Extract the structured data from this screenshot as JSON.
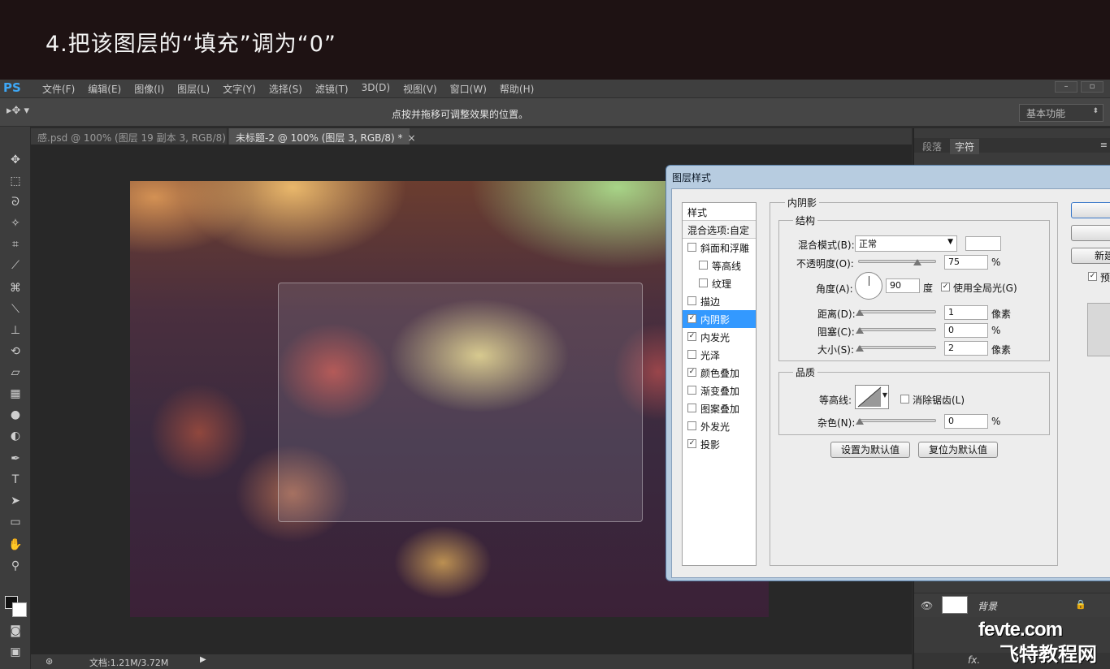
{
  "banner": {
    "text": "4.把该图层的“填充”调为“0”"
  },
  "app": {
    "logo": "PS",
    "menu": [
      "文件(F)",
      "编辑(E)",
      "图像(I)",
      "图层(L)",
      "文字(Y)",
      "选择(S)",
      "滤镜(T)",
      "3D(D)",
      "视图(V)",
      "窗口(W)",
      "帮助(H)"
    ]
  },
  "options_bar": {
    "tool_icon": "move-tool-icon",
    "hint": "点按并拖移可调整效果的位置。",
    "workspace": "基本功能"
  },
  "tabs": [
    {
      "label": "感.psd @ 100% (图层 19 副本 3, RGB/8) *",
      "close": "×"
    },
    {
      "label": "未标题-2 @ 100% (图层 3, RGB/8) *",
      "close": "×"
    }
  ],
  "statusbar": {
    "doc": "文档:1.21M/3.72M",
    "arrow": "▶"
  },
  "right_panel": {
    "tabs": [
      "段落",
      "字符"
    ],
    "bg_layer": {
      "name": "背景"
    }
  },
  "watermark": {
    "line1": "fevte.com",
    "line2": "飞特教程网"
  },
  "dialog": {
    "title": "图层样式",
    "styles_header": "样式",
    "blend_options": "混合选项:自定",
    "style_items": [
      {
        "label": "斜面和浮雕",
        "checked": false,
        "sub": false
      },
      {
        "label": "等高线",
        "checked": false,
        "sub": true
      },
      {
        "label": "纹理",
        "checked": false,
        "sub": true
      },
      {
        "label": "描边",
        "checked": false,
        "sub": false
      },
      {
        "label": "内阴影",
        "checked": true,
        "sub": false,
        "selected": true
      },
      {
        "label": "内发光",
        "checked": true,
        "sub": false
      },
      {
        "label": "光泽",
        "checked": false,
        "sub": false
      },
      {
        "label": "颜色叠加",
        "checked": true,
        "sub": false
      },
      {
        "label": "渐变叠加",
        "checked": false,
        "sub": false
      },
      {
        "label": "图案叠加",
        "checked": false,
        "sub": false
      },
      {
        "label": "外发光",
        "checked": false,
        "sub": false
      },
      {
        "label": "投影",
        "checked": true,
        "sub": false
      }
    ],
    "section_title": "内阴影",
    "structure": {
      "title": "结构",
      "blend_mode_label": "混合模式(B):",
      "blend_mode_value": "正常",
      "opacity_label": "不透明度(O):",
      "opacity_value": "75",
      "opacity_unit": "%",
      "angle_label": "角度(A):",
      "angle_value": "90",
      "angle_unit": "度",
      "global_light_label": "使用全局光(G)",
      "distance_label": "距离(D):",
      "distance_value": "1",
      "distance_unit": "像素",
      "choke_label": "阻塞(C):",
      "choke_value": "0",
      "choke_unit": "%",
      "size_label": "大小(S):",
      "size_value": "2",
      "size_unit": "像素"
    },
    "quality": {
      "title": "品质",
      "contour_label": "等高线:",
      "antialias_label": "消除锯齿(L)",
      "noise_label": "杂色(N):",
      "noise_value": "0",
      "noise_unit": "%"
    },
    "make_default": "设置为默认值",
    "reset_default": "复位为默认值",
    "right_buttons": [
      "确",
      "复",
      "新建样"
    ],
    "preview_label": "预"
  }
}
